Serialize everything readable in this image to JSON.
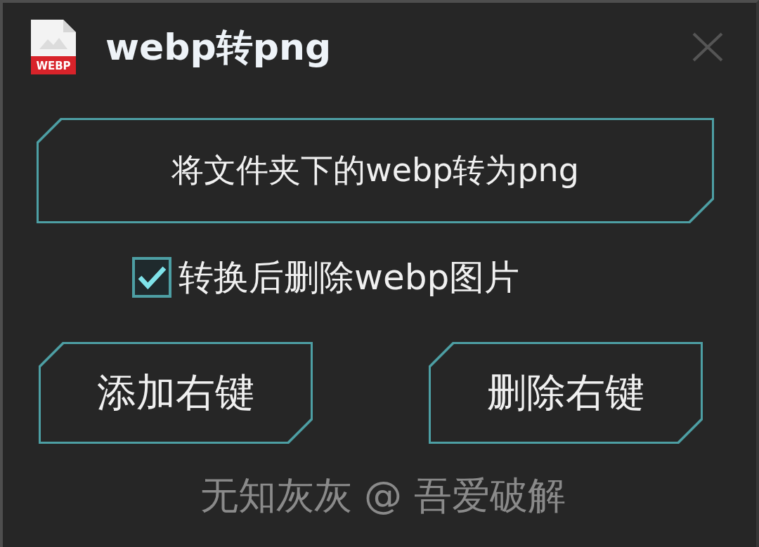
{
  "window": {
    "title": "webp转png",
    "icon_label": "WEBP"
  },
  "convert_button": {
    "label": "将文件夹下的webp转为png"
  },
  "options": [
    {
      "label": "转换后删除webp图片",
      "checked": true
    }
  ],
  "buttons": [
    {
      "label": "添加右键"
    },
    {
      "label": "删除右键"
    }
  ],
  "footer": "无知灰灰 @ 吾爱破解"
}
